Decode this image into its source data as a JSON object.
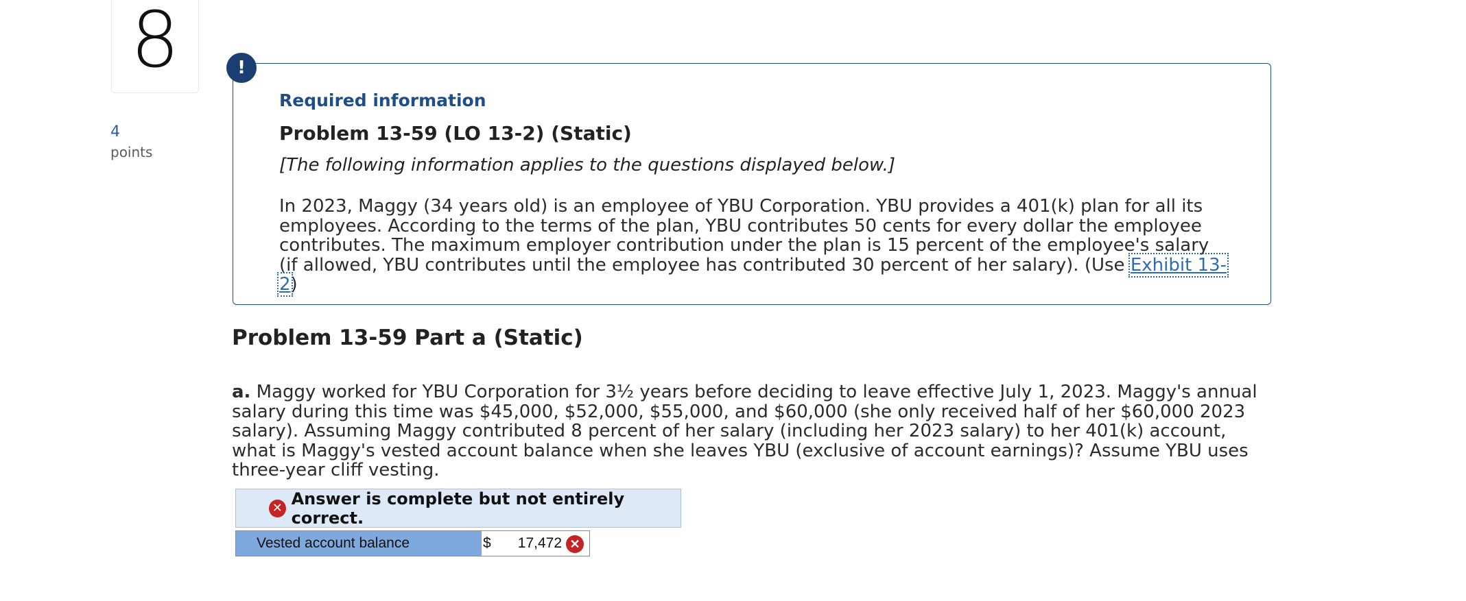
{
  "question": {
    "number": "8",
    "points_value": "4",
    "points_label": "points"
  },
  "alert": {
    "icon_glyph": "!"
  },
  "info": {
    "required_label": "Required information",
    "problem_title": "Problem 13-59 (LO 13-2) (Static)",
    "applies_note": "[The following information applies to the questions displayed below.]",
    "paragraph_main": "In 2023, Maggy (34 years old) is an employee of YBU Corporation. YBU provides a 401(k) plan for all its employees. According to the terms of the plan, YBU contributes 50 cents for every dollar the employee contributes. The maximum employer contribution under the plan is 15 percent of the employee's salary (if allowed, YBU contributes until the employee has contributed 30 percent of her salary). (Use ",
    "exhibit_link": "Exhibit 13-2",
    "paragraph_end": ")"
  },
  "part": {
    "title": "Problem 13-59 Part a (Static)",
    "question_label": "a.",
    "question_text": " Maggy worked for YBU Corporation for 3½ years before deciding to leave effective July 1, 2023. Maggy's annual salary during this time was $45,000, $52,000, $55,000, and $60,000 (she only received half of her $60,000 2023 salary). Assuming Maggy contributed 8 percent of her salary (including her 2023 salary) to her 401(k) account, what is Maggy's vested account balance when she leaves YBU (exclusive of account earnings)? Assume YBU uses three-year cliff vesting."
  },
  "answer": {
    "status": "Answer is complete but not entirely correct.",
    "row_label": "Vested account balance",
    "currency": "$",
    "value": "17,472",
    "x_glyph": "✕"
  },
  "colors": {
    "accent": "#1f4e86",
    "error": "#c52424",
    "label_bg": "#7ea9de",
    "banner_bg": "#dde9f6"
  }
}
